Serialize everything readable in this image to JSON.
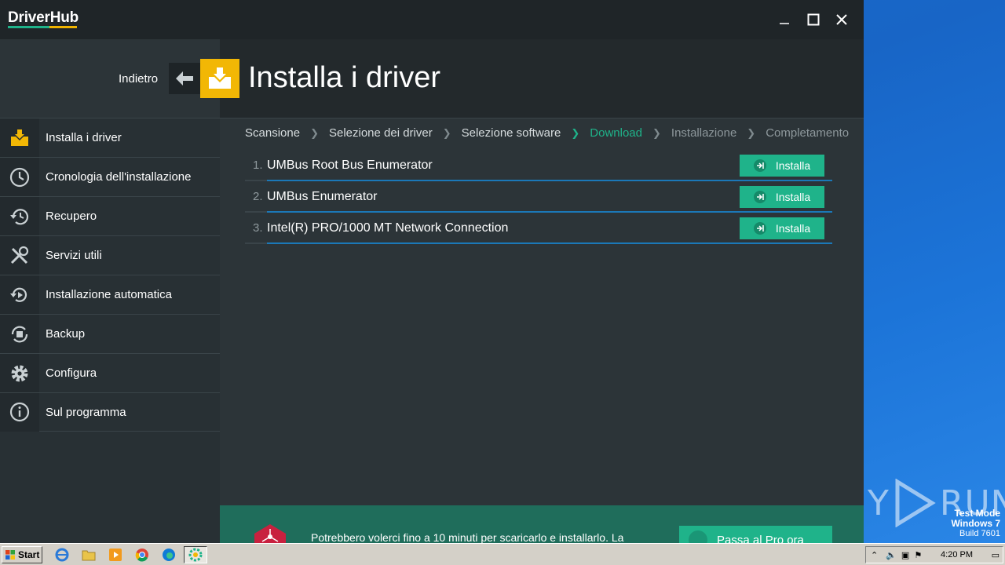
{
  "app": {
    "logo": "DriverHub",
    "window_controls": [
      "minimize",
      "maximize",
      "close"
    ]
  },
  "header": {
    "back_label": "Indietro",
    "title": "Installa i driver"
  },
  "sidebar": {
    "items": [
      {
        "label": "Installa i driver",
        "icon": "install-driver-icon",
        "active": true
      },
      {
        "label": "Cronologia dell'installazione",
        "icon": "clock-icon"
      },
      {
        "label": "Recupero",
        "icon": "history-icon"
      },
      {
        "label": "Servizi utili",
        "icon": "tools-icon"
      },
      {
        "label": "Installazione automatica",
        "icon": "auto-install-icon"
      },
      {
        "label": "Backup",
        "icon": "backup-icon"
      },
      {
        "label": "Configura",
        "icon": "gear-icon"
      },
      {
        "label": "Sul programma",
        "icon": "info-icon"
      }
    ]
  },
  "steps": [
    {
      "label": "Scansione",
      "state": "done"
    },
    {
      "label": "Selezione dei driver",
      "state": "done"
    },
    {
      "label": "Selezione software",
      "state": "done"
    },
    {
      "label": "Download",
      "state": "current"
    },
    {
      "label": "Installazione",
      "state": "todo"
    },
    {
      "label": "Completamento",
      "state": "todo"
    }
  ],
  "drivers": [
    {
      "num": "1.",
      "name": "UMBus Root Bus Enumerator",
      "button": "Installa"
    },
    {
      "num": "2.",
      "name": "UMBus Enumerator",
      "button": "Installa"
    },
    {
      "num": "3.",
      "name": "Intel(R) PRO/1000 MT Network Connection",
      "button": "Installa"
    }
  ],
  "footer": {
    "text": "Potrebbero volerci fino a 10 minuti per scaricarlo e installarlo. La",
    "pro_button": "Passa al Pro ora"
  },
  "desktop": {
    "watermark_left": "ANY",
    "watermark_right": "RUN",
    "test_mode": "Test Mode",
    "os": "Windows 7",
    "build": "Build 7601"
  },
  "taskbar": {
    "start": "Start",
    "clock": "4:20 PM"
  },
  "colors": {
    "accent_green": "#1fb38a",
    "accent_yellow": "#f2b705",
    "underline_blue": "#1b78b8"
  }
}
